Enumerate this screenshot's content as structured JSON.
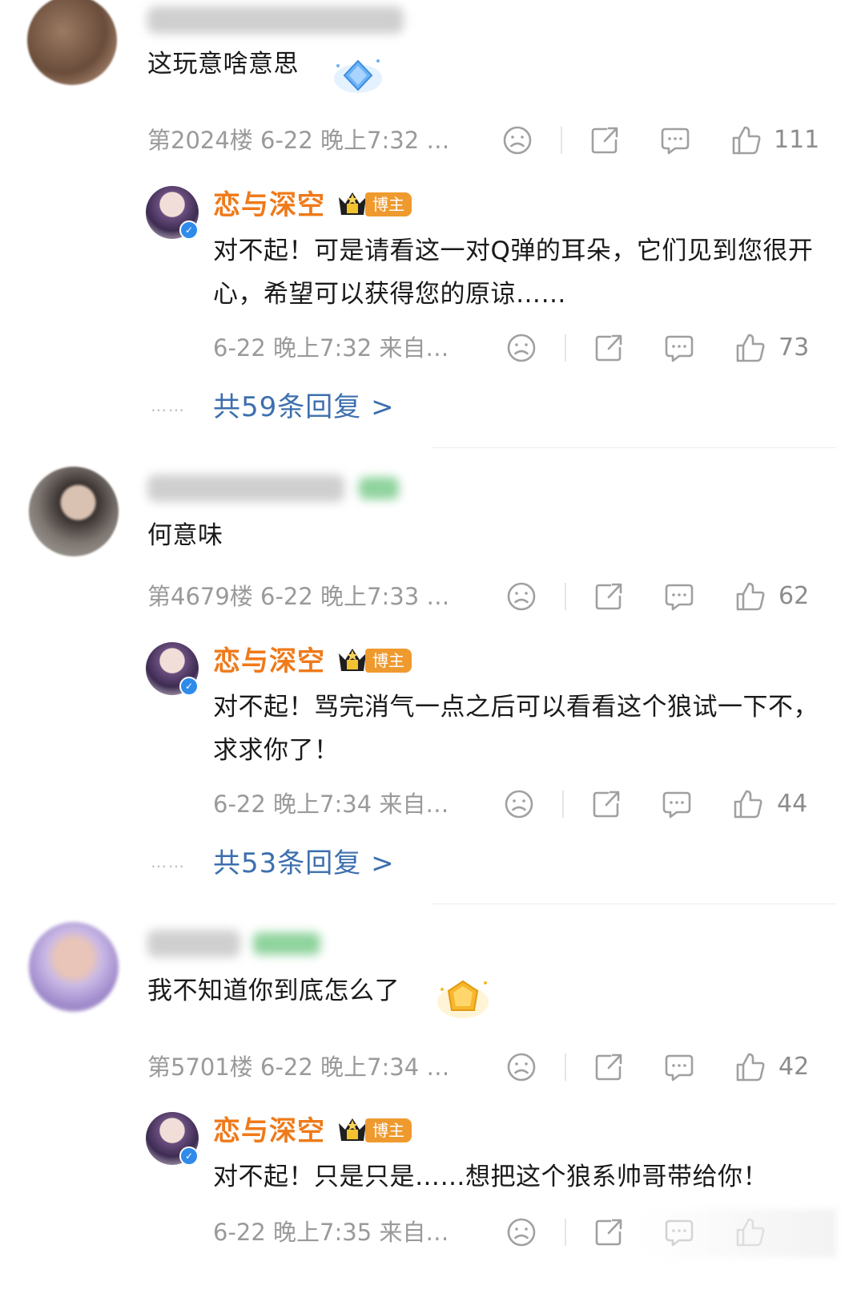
{
  "comments": [
    {
      "text": "这玩意啥意思",
      "meta": "第2024楼 6-22 晚上7:32 …",
      "likes": "111",
      "reply": {
        "name": "恋与深空",
        "badge": "博主",
        "text": "对不起！可是请看这一对Q弹的耳朵，它们见到您很开心，希望可以获得您的原谅……",
        "meta": "6-22 晚上7:32 来自…",
        "likes": "73"
      },
      "more": "共59条回复 >"
    },
    {
      "text": "何意味",
      "meta": "第4679楼 6-22 晚上7:33 …",
      "likes": "62",
      "reply": {
        "name": "恋与深空",
        "badge": "博主",
        "text": "对不起！骂完消气一点之后可以看看这个狼试一下不，求求你了！",
        "meta": "6-22 晚上7:34 来自…",
        "likes": "44"
      },
      "more": "共53条回复 >"
    },
    {
      "text": "我不知道你到底怎么了",
      "meta": "第5701楼 6-22 晚上7:34 …",
      "likes": "42",
      "reply": {
        "name": "恋与深空",
        "badge": "博主",
        "text": "对不起！只是只是……想把这个狼系帅哥带给你！",
        "meta": "6-22 晚上7:35 来自…",
        "likes": ""
      }
    }
  ],
  "dots": "……",
  "icons": {
    "emoji": "sad-face-icon",
    "share": "share-icon",
    "comment": "comment-icon",
    "like": "thumbs-up-icon",
    "verified": "verified-icon",
    "crown": "crown-icon"
  },
  "colors": {
    "reply_name": "#ef7a1a",
    "more_link": "#3d6fae",
    "badge": "#ef9a2e",
    "meta": "#9a9a9a"
  }
}
